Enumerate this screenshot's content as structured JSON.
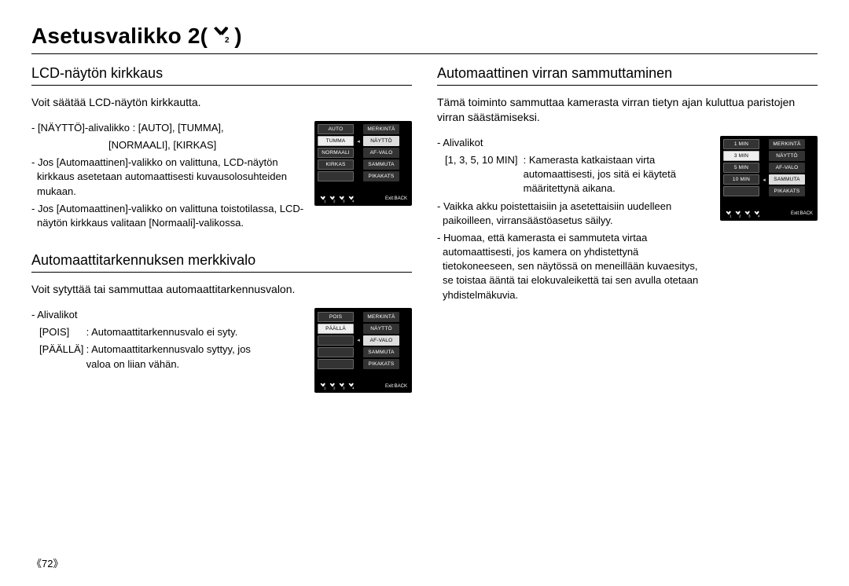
{
  "page_title": "Asetusvalikko 2(",
  "page_title_close": ")",
  "page_number": "《72》",
  "left": {
    "s1": {
      "title": "LCD-näytön kirkkaus",
      "intro": "Voit säätää LCD-näytön kirkkautta.",
      "b1": "- [NÄYTTÖ]-alivalikko : [AUTO], [TUMMA],",
      "b1b": "[NORMAALI], [KIRKAS]",
      "b2": "- Jos [Automaattinen]-valikko on valittuna, LCD-näytön kirkkaus asetetaan automaattisesti kuvausolosuhteiden mukaan.",
      "b3": "- Jos [Automaattinen]-valikko on valittuna toistotilassa, LCD-näytön kirkkaus valitaan [Normaali]-valikossa.",
      "screen": {
        "left": [
          "AUTO",
          "TUMMA",
          "NORMAALI",
          "KIRKAS",
          ""
        ],
        "left_sel": 1,
        "right": [
          "MERKINTÄ",
          "NÄYTTÖ",
          "AF-VALO",
          "SAMMUTA",
          "PIKAKATS"
        ],
        "right_sel": 1,
        "exit": "Exit:BACK"
      }
    },
    "s2": {
      "title": "Automaattitarkennuksen merkkivalo",
      "intro": "Voit sytyttää tai sammuttaa automaattitarkennusvalon.",
      "sub": "- Alivalikot",
      "r1_label": "[POIS]",
      "r1_text": ": Automaattitarkennusvalo ei syty.",
      "r2_label": "[PÄÄLLÄ]",
      "r2_text": ": Automaattitarkennusvalo syttyy, jos valoa on liian vähän.",
      "screen": {
        "left": [
          "POIS",
          "PÄÄLLÄ",
          "",
          "",
          ""
        ],
        "left_sel": 1,
        "right": [
          "MERKINTÄ",
          "NÄYTTÖ",
          "AF-VALO",
          "SAMMUTA",
          "PIKAKATS"
        ],
        "right_sel": 2,
        "exit": "Exit:BACK"
      }
    }
  },
  "right": {
    "s1": {
      "title": "Automaattinen virran sammuttaminen",
      "intro": "Tämä toiminto sammuttaa kamerasta virran tietyn ajan kuluttua paristojen virran säästämiseksi.",
      "sub": "- Alivalikot",
      "r1_label": "[1, 3, 5, 10 MIN]",
      "r1_text": ": Kamerasta katkaistaan virta automaattisesti, jos sitä ei käytetä määritettynä aikana.",
      "b2": "- Vaikka akku poistettaisiin ja asetettaisiin uudelleen paikoilleen, virransäästöasetus säilyy.",
      "b3": "- Huomaa, että kamerasta ei sammuteta virtaa automaattisesti, jos kamera on yhdistettynä tietokoneeseen, sen näytössä on meneillään kuvaesitys, se toistaa ääntä tai elokuvaleikettä tai sen avulla otetaan yhdistelmäkuvia.",
      "screen": {
        "left": [
          "1 MIN",
          "3 MIN",
          "5 MIN",
          "10 MIN",
          ""
        ],
        "left_sel": 1,
        "right": [
          "MERKINTÄ",
          "NÄYTTÖ",
          "AF-VALO",
          "SAMMUTA",
          "PIKAKATS"
        ],
        "right_sel": 3,
        "exit": "Exit:BACK"
      }
    }
  }
}
